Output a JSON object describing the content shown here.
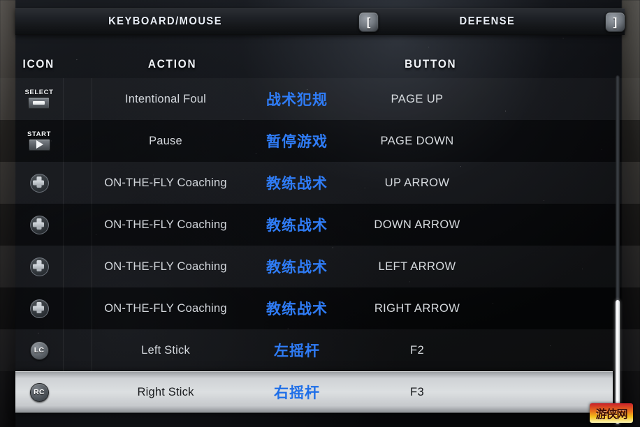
{
  "header": {
    "left_tab": "KEYBOARD/MOUSE",
    "right_tab": "DEFENSE",
    "prev_key": "[",
    "next_key": "]"
  },
  "columns": {
    "icon": "ICON",
    "action": "ACTION",
    "button": "BUTTON"
  },
  "colors": {
    "accent_blue": "#2f7cf6",
    "selected_row": "#dcdfe1",
    "text_primary": "#d3d7dc"
  },
  "scrollbar": {
    "position_percent": 64
  },
  "watermark": {
    "text": "游侠网"
  },
  "rows": [
    {
      "icon_type": "select-button-icon",
      "icon_label": "SELECT",
      "action": "Intentional Foul",
      "action_cn": "战术犯规",
      "button": "PAGE UP",
      "selected": false
    },
    {
      "icon_type": "start-button-icon",
      "icon_label": "START",
      "action": "Pause",
      "action_cn": "暂停游戏",
      "button": "PAGE DOWN",
      "selected": false
    },
    {
      "icon_type": "dpad-icon",
      "icon_label": "",
      "action": "ON-THE-FLY Coaching",
      "action_cn": "教练战术",
      "button": "UP ARROW",
      "selected": false
    },
    {
      "icon_type": "dpad-icon",
      "icon_label": "",
      "action": "ON-THE-FLY Coaching",
      "action_cn": "教练战术",
      "button": "DOWN ARROW",
      "selected": false
    },
    {
      "icon_type": "dpad-icon",
      "icon_label": "",
      "action": "ON-THE-FLY Coaching",
      "action_cn": "教练战术",
      "button": "LEFT ARROW",
      "selected": false
    },
    {
      "icon_type": "dpad-icon",
      "icon_label": "",
      "action": "ON-THE-FLY Coaching",
      "action_cn": "教练战术",
      "button": "RIGHT ARROW",
      "selected": false
    },
    {
      "icon_type": "left-stick-icon",
      "icon_label": "LC",
      "action": "Left Stick",
      "action_cn": "左摇杆",
      "button": "F2",
      "selected": false
    },
    {
      "icon_type": "right-stick-icon",
      "icon_label": "RC",
      "action": "Right Stick",
      "action_cn": "右摇杆",
      "button": "F3",
      "selected": true
    }
  ]
}
